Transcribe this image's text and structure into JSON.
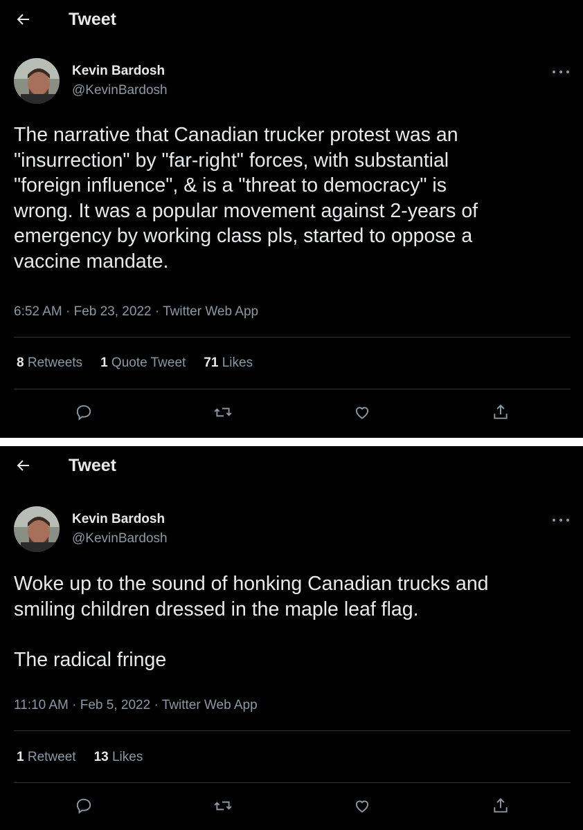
{
  "tweets": [
    {
      "header_title": "Tweet",
      "author_name": "Kevin Bardosh",
      "author_handle": "@KevinBardosh",
      "text": "The narrative that Canadian trucker protest was an\n\"insurrection\" by \"far-right\" forces, with substantial\n\"foreign influence\", & is a \"threat to democracy\" is\nwrong. It was a popular movement against 2-years of\nemergency by working class pls, started to oppose a\nvaccine mandate.",
      "meta": "6:52 AM · Feb 23, 2022 · Twitter Web App",
      "stats": [
        {
          "count": "8",
          "label": "Retweets"
        },
        {
          "count": "1",
          "label": "Quote Tweet"
        },
        {
          "count": "71",
          "label": "Likes"
        }
      ],
      "actions": [
        "reply-icon",
        "retweet-icon",
        "like-icon",
        "share-icon"
      ]
    },
    {
      "header_title": "Tweet",
      "author_name": "Kevin Bardosh",
      "author_handle": "@KevinBardosh",
      "text": "Woke up to the sound of honking Canadian trucks and\nsmiling children dressed in the maple leaf flag.\n\nThe radical fringe",
      "meta": "11:10 AM · Feb 5, 2022 · Twitter Web App",
      "stats": [
        {
          "count": "1",
          "label": "Retweet"
        },
        {
          "count": "13",
          "label": "Likes"
        }
      ],
      "actions": [
        "reply-icon",
        "retweet-icon",
        "like-icon",
        "share-icon"
      ]
    }
  ],
  "colors": {
    "background": "#000000",
    "text": "#e7e9ea",
    "muted": "#8b98a5",
    "divider": "#2f3336"
  }
}
